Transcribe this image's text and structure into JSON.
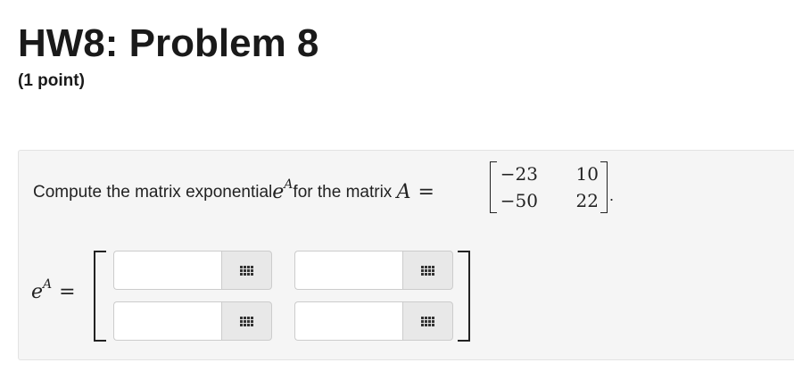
{
  "header": {
    "title": "HW8: Problem 8",
    "points": "(1 point)"
  },
  "problem": {
    "prompt_text": "Compute the matrix exponential ",
    "prompt_var": "e",
    "prompt_sup": "A",
    "prompt_mid": " for the matrix ",
    "matrix_name": "A",
    "equals": "=",
    "matrix": [
      [
        "−23",
        "10"
      ],
      [
        "−50",
        "22"
      ]
    ],
    "period": "."
  },
  "answer": {
    "lhs_base": "e",
    "lhs_sup": "A",
    "equals": "=",
    "fields": [
      {
        "value": "",
        "palette_icon": "matrix-grid-icon"
      },
      {
        "value": "",
        "palette_icon": "matrix-grid-icon"
      },
      {
        "value": "",
        "palette_icon": "matrix-grid-icon"
      },
      {
        "value": "",
        "palette_icon": "matrix-grid-icon"
      }
    ]
  }
}
